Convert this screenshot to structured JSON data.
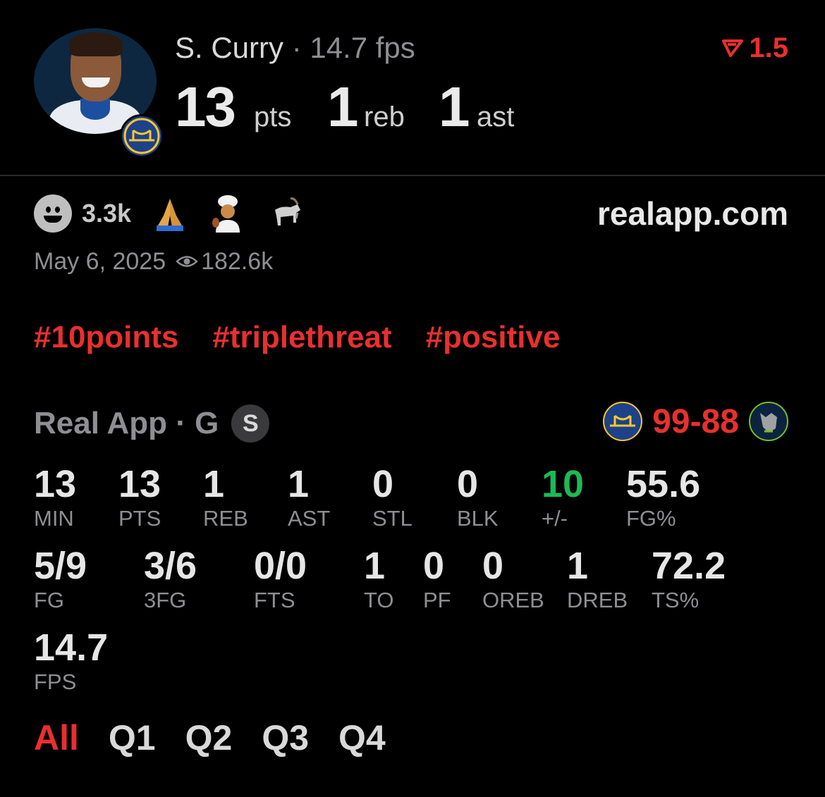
{
  "header": {
    "player_name": "S. Curry",
    "fps_label": "· 14.7 fps",
    "pts": "13",
    "pts_unit": "pts",
    "reb": "1",
    "reb_unit": "reb",
    "ast": "1",
    "ast_unit": "ast",
    "delta": "1.5",
    "delta_color": "#e8302f"
  },
  "reactions": {
    "count": "3.3k",
    "emojis": [
      "smiley-icon",
      "praying-hands-icon",
      "chef-icon",
      "goat-icon"
    ]
  },
  "site": "realapp.com",
  "meta": {
    "date": "May 6, 2025",
    "views": "182.6k"
  },
  "tags": [
    "#10points",
    "#triplethreat",
    "#positive"
  ],
  "game": {
    "source": "Real App · G",
    "badge": "S",
    "score_home": "99",
    "score_sep": "-",
    "score_away": "88",
    "home_color": "#e8302f",
    "away_color": "#e8302f"
  },
  "stats_row1": [
    {
      "value": "13",
      "label": "MIN"
    },
    {
      "value": "13",
      "label": "PTS"
    },
    {
      "value": "1",
      "label": "REB"
    },
    {
      "value": "1",
      "label": "AST"
    },
    {
      "value": "0",
      "label": "STL"
    },
    {
      "value": "0",
      "label": "BLK"
    },
    {
      "value": "10",
      "label": "+/-"
    },
    {
      "value": "55.6",
      "label": "FG%"
    }
  ],
  "stats_row2": [
    {
      "value": "5/9",
      "label": "FG"
    },
    {
      "value": "3/6",
      "label": "3FG"
    },
    {
      "value": "0/0",
      "label": "FTS"
    },
    {
      "value": "1",
      "label": "TO"
    },
    {
      "value": "0",
      "label": "PF"
    },
    {
      "value": "0",
      "label": "OREB"
    },
    {
      "value": "1",
      "label": "DREB"
    },
    {
      "value": "72.2",
      "label": "TS%"
    }
  ],
  "stats_row3": [
    {
      "value": "14.7",
      "label": "FPS"
    }
  ],
  "plus_minus_color": "#1db954",
  "quarters": [
    "All",
    "Q1",
    "Q2",
    "Q3",
    "Q4"
  ],
  "active_quarter": "All"
}
